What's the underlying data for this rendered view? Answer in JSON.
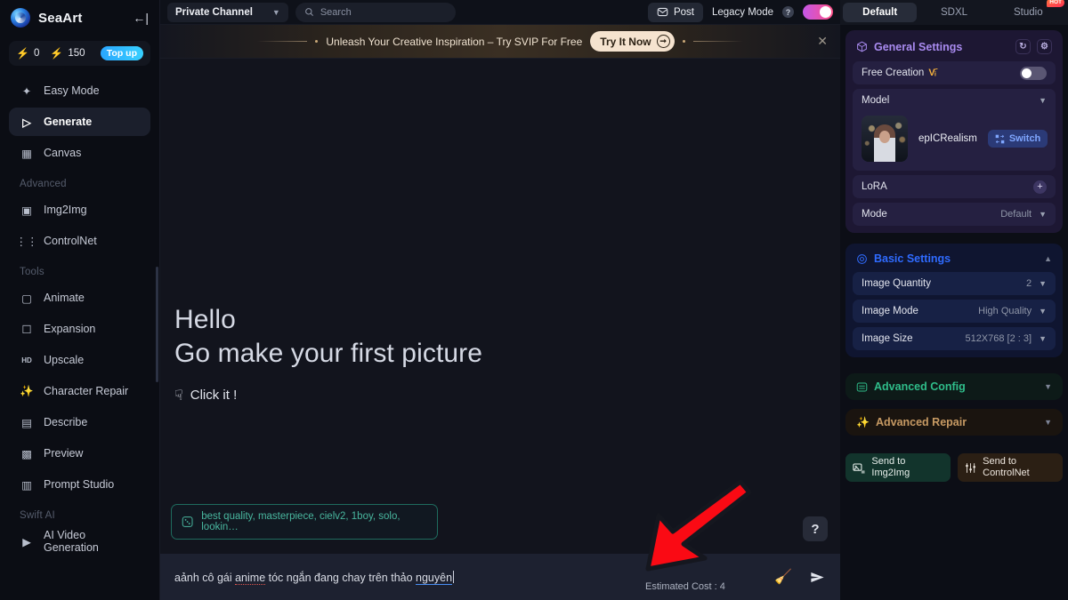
{
  "sidebar": {
    "brand": "SeaArt",
    "collapse_icon": "collapse-left-icon",
    "credits": {
      "purple_icon": "bolt-purple-icon",
      "purple_value": "0",
      "yellow_icon": "bolt-yellow-icon",
      "yellow_value": "150",
      "topup_label": "Top up"
    },
    "items": [
      {
        "label": "Easy Mode",
        "icon": "sparkles-icon",
        "active": false
      },
      {
        "label": "Generate",
        "icon": "play-triangle-icon",
        "active": true
      },
      {
        "label": "Canvas",
        "icon": "canvas-icon",
        "active": false
      }
    ],
    "group_advanced": "Advanced",
    "advanced_items": [
      {
        "label": "Img2Img",
        "icon": "image-stack-icon"
      },
      {
        "label": "ControlNet",
        "icon": "sliders-icon"
      }
    ],
    "group_tools": "Tools",
    "tool_items": [
      {
        "label": "Animate",
        "icon": "animate-icon"
      },
      {
        "label": "Expansion",
        "icon": "expansion-icon"
      },
      {
        "label": "Upscale",
        "icon": "hd-upscale-icon"
      },
      {
        "label": "Character Repair",
        "icon": "magic-wand-icon"
      },
      {
        "label": "Describe",
        "icon": "describe-icon"
      },
      {
        "label": "Preview",
        "icon": "preview-icon"
      },
      {
        "label": "Prompt Studio",
        "icon": "prompt-studio-icon"
      }
    ],
    "group_swift": "Swift AI",
    "swift_items": [
      {
        "label": "AI Video Generation",
        "icon": "video-play-icon"
      }
    ]
  },
  "topbar": {
    "channel": "Private Channel",
    "channel_chevron": "chevron-down-icon",
    "search_placeholder": "Search",
    "search_icon": "search-icon",
    "post_label": "Post",
    "post_icon": "post-icon",
    "legacy_label": "Legacy Mode",
    "legacy_help": "?",
    "legacy_on": true
  },
  "banner": {
    "text": "Unleash Your Creative Inspiration – Try SVIP For Free",
    "cta": "Try It Now",
    "cta_arrow": "arrow-right-icon",
    "close_icon": "close-icon"
  },
  "main": {
    "hello": "Hello",
    "subtitle": "Go make your first picture",
    "click_it": "Click it !",
    "click_icon": "pointing-hand-icon",
    "chip_icon": "dice-icon",
    "chip_text": "best quality, masterpiece, cielv2, 1boy, solo, lookin…",
    "help_label": "?",
    "prompt_value_1": "aảnh cô gái ",
    "prompt_value_red": "anime",
    "prompt_value_2": " tóc ngắn đang chay trên thảo ",
    "prompt_value_blue": "nguyên",
    "prompt_full": "aảnh cô gái anime tóc ngắn đang chay trên thảo nguyên",
    "estimated_cost": "Estimated Cost : 4",
    "wand_icon": "magic-wand-icon",
    "send_icon": "send-paper-plane-icon"
  },
  "right": {
    "tabs": [
      {
        "label": "Default",
        "active": true,
        "badge": ""
      },
      {
        "label": "SDXL",
        "active": false,
        "badge": ""
      },
      {
        "label": "Studio",
        "active": false,
        "badge": "HOT"
      }
    ],
    "general": {
      "title": "General Settings",
      "icon": "cube-icon",
      "refresh_icon": "refresh-icon",
      "gear_icon": "gear-icon",
      "free_creation_label": "Free Creation",
      "free_creation_vip": "VIP",
      "free_creation_on": false,
      "model_label": "Model",
      "model_name": "epICRealism",
      "switch_label": "Switch",
      "switch_icon": "switch-icon",
      "lora_label": "LoRA",
      "lora_add": "+",
      "mode_label": "Mode",
      "mode_value": "Default"
    },
    "basic": {
      "title": "Basic Settings",
      "icon": "target-icon",
      "rows": [
        {
          "label": "Image Quantity",
          "value": "2"
        },
        {
          "label": "Image Mode",
          "value": "High Quality"
        },
        {
          "label": "Image Size",
          "value": "512X768   [2 : 3]"
        }
      ]
    },
    "advanced_config": {
      "title": "Advanced Config",
      "icon": "config-icon"
    },
    "advanced_repair": {
      "title": "Advanced Repair",
      "icon": "repair-wand-icon"
    },
    "send_img2img": "Send to Img2Img",
    "send_controlnet": "Send to ControlNet"
  },
  "colors": {
    "accent_purple": "#a98bf0",
    "accent_blue": "#2f6bff",
    "accent_green": "#2fbd8a",
    "accent_gold": "#c79a63",
    "arrow_red": "#fa0a14",
    "topup_blue": "#2aa6ff"
  }
}
